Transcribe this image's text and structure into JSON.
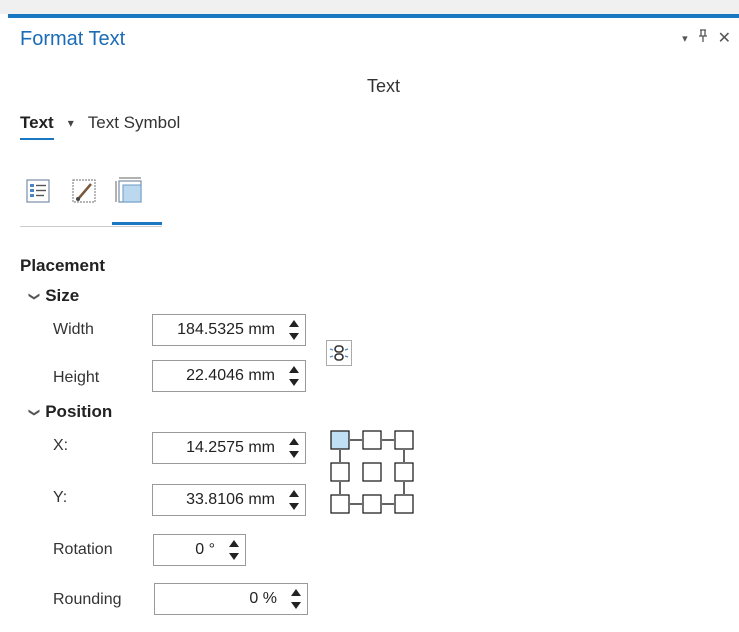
{
  "pane": {
    "title": "Format Text",
    "controls": {
      "dropdown": "▾",
      "pin": "ᚬ",
      "close": "✕"
    }
  },
  "heading": "Text",
  "tabs": [
    {
      "label": "Text",
      "active": true
    },
    {
      "label": "Text Symbol",
      "active": false
    }
  ],
  "tab_dropdown": "▾",
  "icons": [
    "general-properties-icon",
    "symbol-edit-icon",
    "placement-icon"
  ],
  "placement": {
    "title": "Placement",
    "size": {
      "title": "Size",
      "width_label": "Width",
      "width_value": "184.5325 mm",
      "height_label": "Height",
      "height_value": "22.4046 mm"
    },
    "position": {
      "title": "Position",
      "x_label": "X:",
      "x_value": "14.2575 mm",
      "y_label": "Y:",
      "y_value": "33.8106 mm",
      "rotation_label": "Rotation",
      "rotation_value": "0 °",
      "rounding_label": "Rounding",
      "rounding_value": "0 %"
    }
  },
  "colors": {
    "accent": "#1a78c2",
    "title": "#1c6bb6",
    "anchor_selected": "#bfe0f5"
  }
}
